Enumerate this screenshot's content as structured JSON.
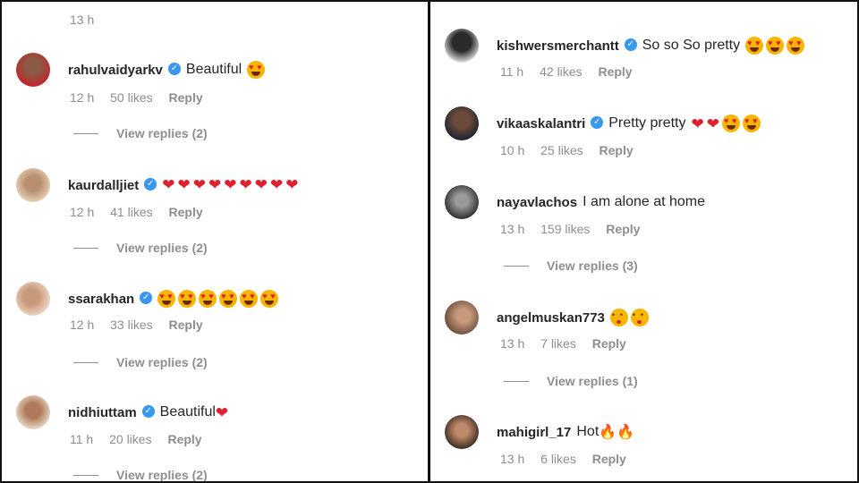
{
  "left": {
    "top_meta": "13 h",
    "comments": [
      {
        "username": "rahulvaidyarkv",
        "verified": true,
        "text": "Beautiful",
        "time": "12 h",
        "likes": "50 likes",
        "reply": "Reply",
        "view_replies": "View replies (2)"
      },
      {
        "username": "kaurdalljiet",
        "verified": true,
        "text": "",
        "time": "12 h",
        "likes": "41 likes",
        "reply": "Reply",
        "view_replies": "View replies (2)"
      },
      {
        "username": "ssarakhan",
        "verified": true,
        "text": "",
        "time": "12 h",
        "likes": "33 likes",
        "reply": "Reply",
        "view_replies": "View replies (2)"
      },
      {
        "username": "nidhiuttam",
        "verified": true,
        "text": "Beautiful",
        "time": "11 h",
        "likes": "20 likes",
        "reply": "Reply",
        "view_replies": "View replies (2)"
      }
    ]
  },
  "right": {
    "comments": [
      {
        "username": "kishwersmerchantt",
        "verified": true,
        "text": "So so So pretty",
        "time": "11 h",
        "likes": "42 likes",
        "reply": "Reply"
      },
      {
        "username": "vikaaskalantri",
        "verified": true,
        "text": "Pretty pretty",
        "time": "10 h",
        "likes": "25 likes",
        "reply": "Reply"
      },
      {
        "username": "nayavlachos",
        "verified": false,
        "text": "I am alone at home",
        "time": "13 h",
        "likes": "159 likes",
        "reply": "Reply",
        "view_replies": "View replies (3)"
      },
      {
        "username": "angelmuskan773",
        "verified": false,
        "text": "",
        "time": "13 h",
        "likes": "7 likes",
        "reply": "Reply",
        "view_replies": "View replies (1)"
      },
      {
        "username": "mahigirl_17",
        "verified": false,
        "text": "Hot",
        "time": "13 h",
        "likes": "6 likes",
        "reply": "Reply"
      }
    ]
  },
  "colors": {
    "verified_badge": "#3897f0",
    "meta_text": "#8e8e8e",
    "heart": "#e0202e"
  },
  "icons": {
    "verified": "verified-badge-icon",
    "heart": "red-heart-emoji",
    "heart_eyes": "heart-eyes-emoji",
    "fire": "fire-emoji",
    "kiss": "kissing-face-emoji"
  }
}
